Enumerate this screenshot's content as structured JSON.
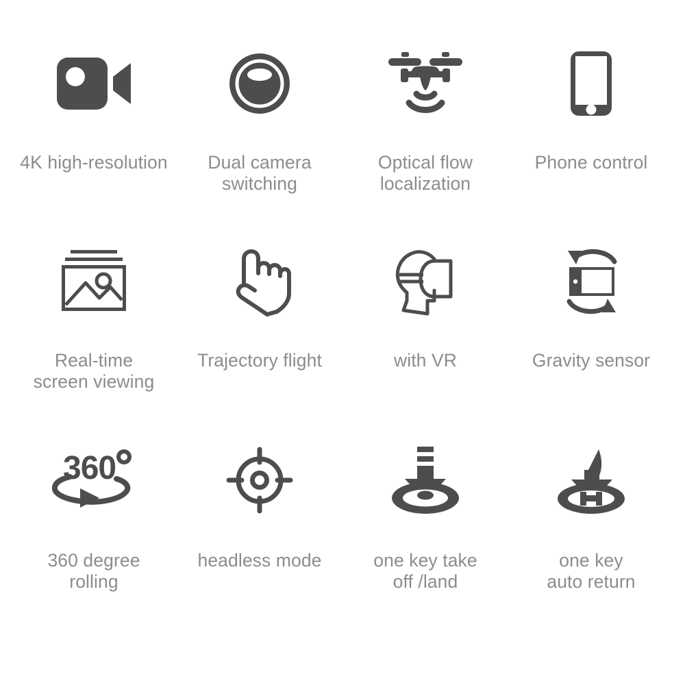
{
  "page": {
    "background_color": "#ffffff",
    "icon_color": "#4d4d4d",
    "label_color": "#8c8c8c"
  },
  "features": [
    {
      "icon": "video-camera-icon",
      "label": "4K high-resolution"
    },
    {
      "icon": "dual-camera-lens-icon",
      "label": "Dual camera\nswitching"
    },
    {
      "icon": "drone-signal-icon",
      "label": "Optical flow\nlocalization"
    },
    {
      "icon": "smartphone-icon",
      "label": "Phone control"
    },
    {
      "icon": "photo-gallery-icon",
      "label": "Real-time\nscreen viewing"
    },
    {
      "icon": "pointing-hand-icon",
      "label": "Trajectory flight"
    },
    {
      "icon": "vr-headset-head-icon",
      "label": "with VR"
    },
    {
      "icon": "device-rotation-icon",
      "label": "Gravity sensor"
    },
    {
      "icon": "360-degree-rotation-icon",
      "label": "360 degree\nrolling"
    },
    {
      "icon": "crosshair-target-icon",
      "label": "headless mode"
    },
    {
      "icon": "takeoff-land-arrow-icon",
      "label": "one key take\noff /land"
    },
    {
      "icon": "auto-return-helipad-icon",
      "label": "one key\nauto return"
    }
  ]
}
